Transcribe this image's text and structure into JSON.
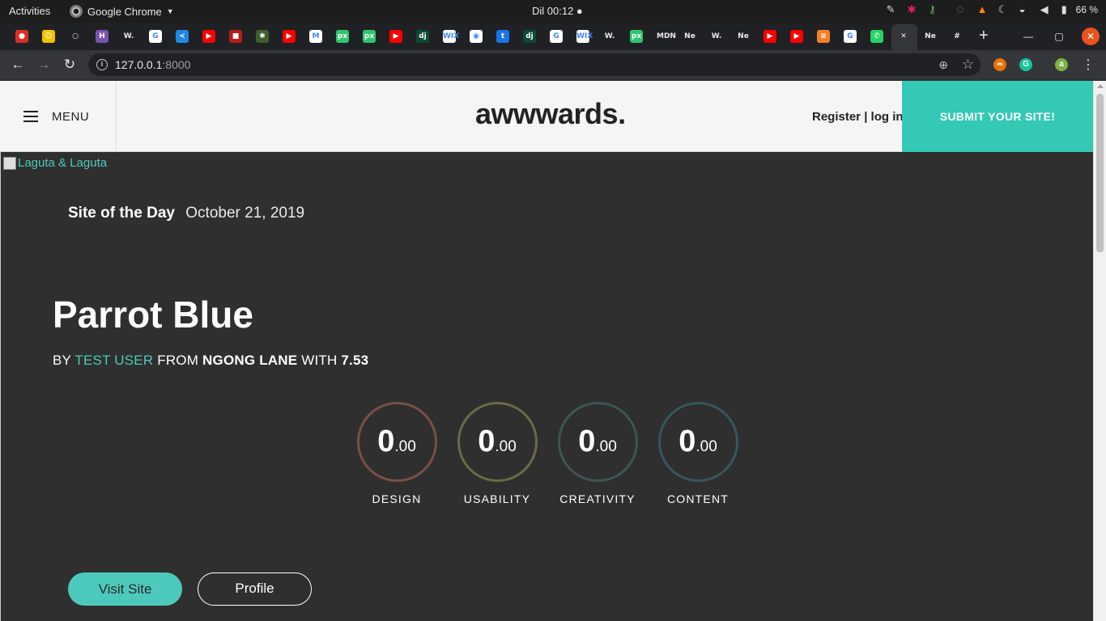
{
  "os_bar": {
    "activities": "Activities",
    "app_name": "Google Chrome",
    "clock": "Dil 00:12 ●",
    "battery": "66 %"
  },
  "tabs": [
    {
      "icon": "tomato-icon",
      "color": "#d93025",
      "glyph": "●"
    },
    {
      "icon": "noodles-icon",
      "color": "#f2c400",
      "glyph": "☺"
    },
    {
      "icon": "github-icon",
      "color": "#202124",
      "glyph": "○"
    },
    {
      "icon": "heroku-icon",
      "color": "#7952b3",
      "glyph": "H"
    },
    {
      "icon": "wikipedia-icon",
      "color": "#202124",
      "glyph": "W."
    },
    {
      "icon": "google-icon",
      "color": "#ffffff",
      "glyph": "G"
    },
    {
      "icon": "vscode-icon",
      "color": "#1e88e5",
      "glyph": "≺"
    },
    {
      "icon": "youtube-icon",
      "color": "#ff0000",
      "glyph": "▶"
    },
    {
      "icon": "red-square-icon",
      "color": "#b71c1c",
      "glyph": "■"
    },
    {
      "icon": "tree-icon",
      "color": "#3e5f2e",
      "glyph": "✱"
    },
    {
      "icon": "youtube-icon",
      "color": "#ff0000",
      "glyph": "▶"
    },
    {
      "icon": "gmail-icon",
      "color": "#ffffff",
      "glyph": "M"
    },
    {
      "icon": "pixabay-icon",
      "color": "#2ec66d",
      "glyph": "px"
    },
    {
      "icon": "pixabay-icon",
      "color": "#2ec66d",
      "glyph": "px"
    },
    {
      "icon": "youtube-icon",
      "color": "#ff0000",
      "glyph": "▶"
    },
    {
      "icon": "django-icon",
      "color": "#0c4b33",
      "glyph": "dj"
    },
    {
      "icon": "wix-icon",
      "color": "#ffffff",
      "glyph": "WIX"
    },
    {
      "icon": "globe-icon",
      "color": "#ffffff",
      "glyph": "◉"
    },
    {
      "icon": "tumblr-icon",
      "color": "#1a73e8",
      "glyph": "t"
    },
    {
      "icon": "django-icon",
      "color": "#0c4b33",
      "glyph": "dj"
    },
    {
      "icon": "google-icon",
      "color": "#ffffff",
      "glyph": "G"
    },
    {
      "icon": "wix-icon",
      "color": "#ffffff",
      "glyph": "WIX"
    },
    {
      "icon": "wikipedia-icon",
      "color": "#202124",
      "glyph": "W."
    },
    {
      "icon": "pixabay-icon",
      "color": "#2ec66d",
      "glyph": "px"
    },
    {
      "icon": "mdn-icon",
      "color": "#202124",
      "glyph": "MDN"
    },
    {
      "icon": "netflix-tab-icon",
      "color": "#202124",
      "glyph": "Ne"
    },
    {
      "icon": "wikipedia-icon",
      "color": "#202124",
      "glyph": "W."
    },
    {
      "icon": "netflix-tab-icon",
      "color": "#202124",
      "glyph": "Ne"
    },
    {
      "icon": "youtube-icon",
      "color": "#ff0000",
      "glyph": "▶"
    },
    {
      "icon": "youtube-icon",
      "color": "#ff0000",
      "glyph": "▶"
    },
    {
      "icon": "stackoverflow-icon",
      "color": "#f48024",
      "glyph": "≡"
    },
    {
      "icon": "google-icon",
      "color": "#ffffff",
      "glyph": "G"
    },
    {
      "icon": "whatsapp-icon",
      "color": "#25d366",
      "glyph": "✆"
    },
    {
      "icon": "close-tab-icon",
      "color": "#35363a",
      "glyph": "✕"
    },
    {
      "icon": "netflix-tab-icon",
      "color": "#202124",
      "glyph": "Ne"
    },
    {
      "icon": "slack-icon",
      "color": "#202124",
      "glyph": "#"
    }
  ],
  "toolbar": {
    "url_host": "127.0.0.1",
    "url_port": ":8000"
  },
  "header": {
    "menu_label": "MENU",
    "logo": "awwwards.",
    "auth_text": "Register | log in",
    "submit_label": "SUBMIT YOUR SITE!"
  },
  "hero": {
    "image_alt": "Laguta & Laguta",
    "sotd_label": "Site of the Day",
    "sotd_date": "October 21, 2019",
    "title": "Parrot Blue",
    "by": "BY",
    "user": "TEST USER",
    "from": "FROM",
    "location": "NGONG LANE",
    "with": "WITH",
    "score": "7.53",
    "ratings": [
      {
        "label": "DESIGN",
        "whole": "0",
        "decimal": ".00",
        "color": "#7a4f47"
      },
      {
        "label": "USABILITY",
        "whole": "0",
        "decimal": ".00",
        "color": "#6b6a48"
      },
      {
        "label": "CREATIVITY",
        "whole": "0",
        "decimal": ".00",
        "color": "#3c5654"
      },
      {
        "label": "CONTENT",
        "whole": "0",
        "decimal": ".00",
        "color": "#365660"
      }
    ],
    "visit_label": "Visit Site",
    "profile_label": "Profile"
  }
}
